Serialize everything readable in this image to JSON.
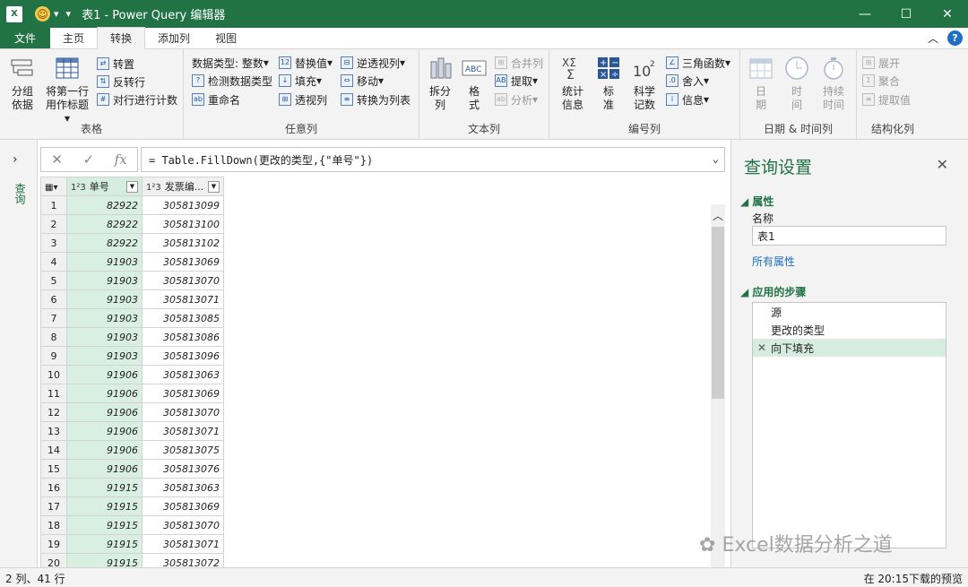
{
  "app": {
    "logo": "X",
    "title": "表1 - Power Query 编辑器"
  },
  "tabs": [
    {
      "label": "文件"
    },
    {
      "label": "主页"
    },
    {
      "label": "转换"
    },
    {
      "label": "添加列"
    },
    {
      "label": "视图"
    }
  ],
  "ribbon": {
    "table_group": {
      "label": "表格",
      "group_by": "分组\n依据",
      "use_first_row": "将第一行\n用作标题",
      "transpose": "转置",
      "reverse_rows": "反转行",
      "count_rows": "对行进行计数"
    },
    "any_column": {
      "label": "任意列",
      "data_type": "数据类型: 整数",
      "detect_type": "检测数据类型",
      "rename": "重命名",
      "replace_values": "替换值",
      "fill": "填充",
      "pivot": "透视列",
      "unpivot": "逆透视列",
      "move": "移动",
      "to_list": "转换为列表"
    },
    "text_column": {
      "label": "文本列",
      "split": "拆分\n列",
      "format": "格\n式",
      "merge": "合并列",
      "extract": "提取",
      "parse": "分析"
    },
    "number_column": {
      "label": "编号列",
      "statistics": "统计\n信息",
      "standard": "标\n准",
      "scientific": "科学\n记数",
      "trig": "三角函数",
      "rounding": "舍入",
      "information": "信息"
    },
    "datetime": {
      "label": "日期 & 时间列",
      "date": "日\n期",
      "time": "时\n间",
      "duration": "持续\n时间"
    },
    "structured": {
      "label": "结构化列",
      "expand": "展开",
      "aggregate": "聚合",
      "extract_values": "提取值"
    }
  },
  "left_pane": {
    "label": "查询"
  },
  "formula_bar": {
    "formula": "= Table.FillDown(更改的类型,{\"单号\"})"
  },
  "grid": {
    "columns": [
      {
        "type": "1²3",
        "name": "单号"
      },
      {
        "type": "1²3",
        "name": "发票编..."
      }
    ],
    "rows": [
      [
        "1",
        "82922",
        "305813099"
      ],
      [
        "2",
        "82922",
        "305813100"
      ],
      [
        "3",
        "82922",
        "305813102"
      ],
      [
        "4",
        "91903",
        "305813069"
      ],
      [
        "5",
        "91903",
        "305813070"
      ],
      [
        "6",
        "91903",
        "305813071"
      ],
      [
        "7",
        "91903",
        "305813085"
      ],
      [
        "8",
        "91903",
        "305813086"
      ],
      [
        "9",
        "91903",
        "305813096"
      ],
      [
        "10",
        "91906",
        "305813063"
      ],
      [
        "11",
        "91906",
        "305813069"
      ],
      [
        "12",
        "91906",
        "305813070"
      ],
      [
        "13",
        "91906",
        "305813071"
      ],
      [
        "14",
        "91906",
        "305813075"
      ],
      [
        "15",
        "91906",
        "305813076"
      ],
      [
        "16",
        "91915",
        "305813063"
      ],
      [
        "17",
        "91915",
        "305813069"
      ],
      [
        "18",
        "91915",
        "305813070"
      ],
      [
        "19",
        "91915",
        "305813071"
      ],
      [
        "20",
        "91915",
        "305813072"
      ]
    ]
  },
  "query_settings": {
    "title": "查询设置",
    "properties_label": "属性",
    "name_label": "名称",
    "name_value": "表1",
    "all_properties": "所有属性",
    "steps_label": "应用的步骤",
    "steps": [
      "源",
      "更改的类型",
      "向下填充"
    ],
    "selected_step": 2
  },
  "status": {
    "left": "2 列、41 行",
    "right": "在 20:15下载的预览"
  },
  "watermark": "Excel数据分析之道",
  "colors": {
    "accent": "#217346",
    "selection": "#d6ece0"
  }
}
